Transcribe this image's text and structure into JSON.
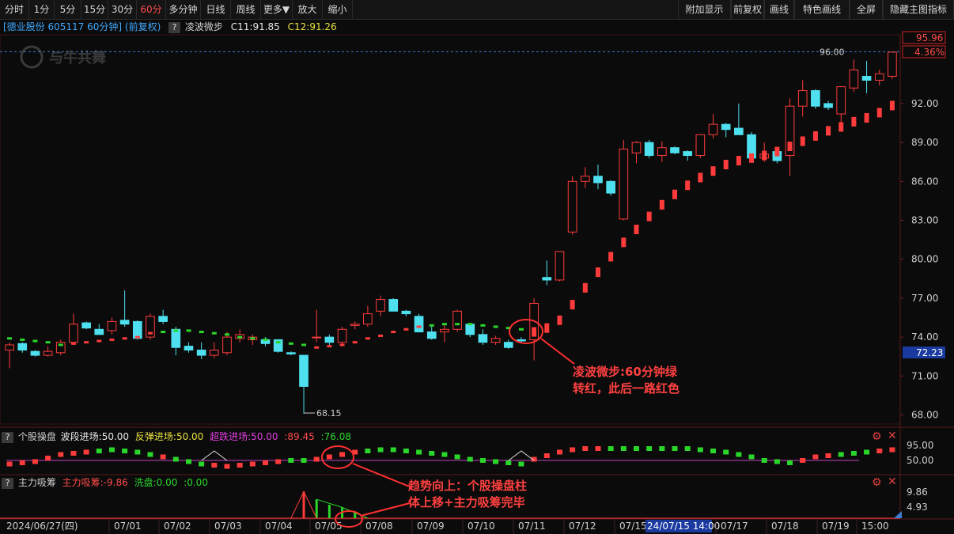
{
  "toolbar": {
    "left": [
      "分时",
      "1分",
      "5分",
      "15分",
      "30分",
      "60分",
      "多分钟",
      "日线",
      "周线",
      "更多▼",
      "放大",
      "缩小"
    ],
    "active": "60分",
    "right": [
      "附加显示",
      "前复权",
      "画线",
      "特色画线",
      "全屏",
      "隐藏主图指标"
    ]
  },
  "info": {
    "stock": "[德业股份 605117 60分钟] (前复权)",
    "indicator_name": "凌波微步",
    "c1": "C11:91.85",
    "c2": "C12:91.26",
    "watermark": "与牛共舞"
  },
  "price_axis": {
    "ticks": [
      "92.00",
      "89.00",
      "86.00",
      "83.00",
      "80.00",
      "77.00",
      "74.00",
      "71.00",
      "68.00"
    ],
    "current_price": "95.96",
    "current_pct": "4.36%",
    "cursor_price": "72.23",
    "high_label": "96.00",
    "low_label": "68.15"
  },
  "ind1": {
    "q": "?",
    "name": "个股操盘",
    "p1": "波段进场:50.00",
    "p2": "反弹进场:50.00",
    "p3": "超跌进场:50.00",
    "p4": ":89.45",
    "p5": ":76.08",
    "axis": [
      "95.00",
      "50.00"
    ]
  },
  "ind2": {
    "q": "?",
    "name": "主力吸筹",
    "p1": "主力吸筹:-9.86",
    "p2": "洗盘:0.00",
    "p3": ":0.00",
    "axis": [
      "9.86",
      "4.93"
    ]
  },
  "time_axis": [
    "2024/06/27(四)",
    "07/01",
    "07/02",
    "07/03",
    "07/04",
    "07/05",
    "07/08",
    "07/09",
    "07/10",
    "07/11",
    "07/12",
    "07/15",
    "24/07/15 14:00",
    "07/17",
    "07/18",
    "07/19",
    "15:00"
  ],
  "annotations": {
    "a1_line1": "凌波微步:60分钟绿",
    "a1_line2": "转红，此后一路红色",
    "a2_line1": "趋势向上：个股操盘柱",
    "a2_line2": "体上移+主力吸筹完毕"
  },
  "colors": {
    "up": "#ff3b3b",
    "down": "#4fe0f0",
    "green": "#2bd62b",
    "purple": "#c040c0",
    "blue_dash": "#3a7fd0"
  },
  "chart_data": {
    "type": "candlestick",
    "ylim": [
      67.3,
      97.3
    ],
    "candles": [
      [
        73.0,
        73.6,
        71.6,
        73.4
      ],
      [
        73.5,
        73.6,
        72.8,
        73.0
      ],
      [
        72.9,
        73.0,
        72.5,
        72.6
      ],
      [
        72.6,
        73.3,
        72.5,
        72.9
      ],
      [
        72.8,
        73.8,
        72.6,
        73.6
      ],
      [
        73.6,
        75.8,
        73.4,
        75.0
      ],
      [
        75.1,
        75.2,
        74.6,
        74.7
      ],
      [
        74.6,
        75.0,
        74.2,
        74.2
      ],
      [
        74.5,
        75.5,
        74.2,
        75.2
      ],
      [
        75.3,
        77.6,
        74.8,
        75.0
      ],
      [
        75.2,
        75.3,
        73.8,
        73.9
      ],
      [
        74.0,
        75.8,
        73.8,
        75.6
      ],
      [
        75.6,
        76.1,
        75.0,
        75.2
      ],
      [
        74.6,
        74.8,
        72.6,
        73.2
      ],
      [
        73.3,
        73.6,
        72.8,
        73.0
      ],
      [
        73.0,
        73.6,
        72.3,
        72.6
      ],
      [
        72.6,
        73.6,
        72.4,
        73.0
      ],
      [
        72.8,
        74.4,
        72.6,
        74.0
      ],
      [
        73.9,
        74.6,
        73.6,
        74.2
      ],
      [
        73.8,
        74.2,
        73.4,
        74.0
      ],
      [
        73.8,
        74.0,
        73.3,
        73.5
      ],
      [
        73.8,
        73.8,
        72.8,
        72.9
      ],
      [
        72.8,
        72.9,
        72.6,
        72.7
      ],
      [
        72.6,
        72.6,
        68.1,
        70.2
      ],
      [
        74.0,
        76.1,
        73.6,
        74.0
      ],
      [
        74.0,
        74.2,
        73.4,
        73.6
      ],
      [
        73.6,
        74.8,
        73.3,
        74.6
      ],
      [
        74.9,
        75.2,
        74.6,
        75.0
      ],
      [
        75.0,
        76.4,
        74.8,
        75.8
      ],
      [
        76.0,
        77.2,
        75.6,
        76.9
      ],
      [
        76.9,
        77.0,
        76.0,
        76.0
      ],
      [
        76.0,
        76.1,
        75.6,
        75.8
      ],
      [
        75.6,
        75.8,
        74.4,
        74.4
      ],
      [
        74.4,
        74.8,
        73.8,
        73.9
      ],
      [
        74.4,
        74.9,
        73.6,
        74.6
      ],
      [
        74.6,
        76.1,
        74.4,
        76.0
      ],
      [
        75.0,
        75.1,
        74.0,
        74.2
      ],
      [
        74.2,
        74.6,
        73.4,
        73.6
      ],
      [
        73.6,
        74.1,
        73.4,
        73.9
      ],
      [
        73.6,
        73.8,
        73.1,
        73.2
      ],
      [
        73.8,
        74.0,
        73.5,
        73.7
      ],
      [
        73.8,
        77.0,
        72.2,
        76.6
      ],
      [
        78.6,
        79.9,
        78.0,
        78.4
      ],
      [
        78.4,
        80.6,
        78.3,
        80.6
      ],
      [
        82.1,
        86.4,
        81.9,
        86.0
      ],
      [
        86.0,
        87.1,
        85.5,
        86.4
      ],
      [
        86.4,
        87.3,
        85.4,
        85.9
      ],
      [
        86.0,
        86.1,
        84.9,
        85.1
      ],
      [
        83.1,
        89.2,
        83.0,
        88.5
      ],
      [
        88.2,
        89.1,
        87.4,
        89.0
      ],
      [
        89.0,
        89.2,
        87.8,
        88.0
      ],
      [
        88.0,
        89.1,
        87.5,
        88.6
      ],
      [
        88.6,
        88.7,
        88.1,
        88.2
      ],
      [
        88.3,
        88.4,
        87.6,
        88.0
      ],
      [
        88.0,
        89.6,
        87.8,
        89.6
      ],
      [
        89.6,
        91.2,
        89.3,
        90.4
      ],
      [
        90.4,
        90.5,
        89.4,
        90.0
      ],
      [
        90.1,
        92.0,
        89.6,
        89.6
      ],
      [
        89.6,
        89.8,
        87.6,
        87.8
      ],
      [
        87.8,
        89.0,
        87.5,
        88.1
      ],
      [
        88.3,
        88.4,
        87.4,
        87.6
      ],
      [
        88.0,
        92.4,
        86.4,
        91.8
      ],
      [
        91.8,
        93.8,
        91.0,
        93.0
      ],
      [
        93.0,
        93.1,
        91.6,
        91.8
      ],
      [
        92.0,
        92.2,
        91.5,
        91.7
      ],
      [
        91.2,
        93.2,
        90.2,
        93.3
      ],
      [
        93.2,
        95.4,
        92.9,
        94.6
      ],
      [
        94.1,
        95.3,
        92.8,
        93.8
      ],
      [
        93.8,
        94.6,
        93.4,
        94.3
      ],
      [
        94.1,
        96.0,
        93.9,
        95.96
      ]
    ],
    "lbwb_line": [
      [
        73.9,
        "g"
      ],
      [
        73.8,
        "g"
      ],
      [
        73.7,
        "g"
      ],
      [
        73.6,
        "g"
      ],
      [
        73.4,
        "g"
      ],
      [
        73.5,
        "r"
      ],
      [
        73.6,
        "r"
      ],
      [
        73.7,
        "r"
      ],
      [
        73.8,
        "r"
      ],
      [
        73.9,
        "r"
      ],
      [
        74.0,
        "r"
      ],
      [
        74.3,
        "r"
      ],
      [
        74.4,
        "g"
      ],
      [
        74.5,
        "g"
      ],
      [
        74.5,
        "g"
      ],
      [
        74.4,
        "g"
      ],
      [
        74.3,
        "g"
      ],
      [
        74.2,
        "g"
      ],
      [
        74.0,
        "g"
      ],
      [
        73.9,
        "g"
      ],
      [
        73.8,
        "g"
      ],
      [
        73.6,
        "g"
      ],
      [
        73.5,
        "g"
      ],
      [
        73.4,
        "g"
      ],
      [
        73.2,
        "r"
      ],
      [
        73.3,
        "r"
      ],
      [
        73.4,
        "r"
      ],
      [
        73.6,
        "r"
      ],
      [
        73.9,
        "r"
      ],
      [
        74.1,
        "r"
      ],
      [
        74.4,
        "r"
      ],
      [
        74.6,
        "r"
      ],
      [
        74.8,
        "r"
      ],
      [
        74.9,
        "g"
      ],
      [
        75.0,
        "g"
      ],
      [
        75.0,
        "g"
      ],
      [
        75.0,
        "g"
      ],
      [
        74.9,
        "g"
      ],
      [
        74.8,
        "g"
      ],
      [
        74.7,
        "g"
      ],
      [
        74.6,
        "g"
      ],
      [
        74.4,
        "r"
      ],
      [
        74.7,
        "r"
      ],
      [
        75.3,
        "r"
      ],
      [
        76.5,
        "r"
      ],
      [
        77.8,
        "r"
      ],
      [
        79.0,
        "r"
      ],
      [
        80.2,
        "r"
      ],
      [
        81.3,
        "r"
      ],
      [
        82.3,
        "r"
      ],
      [
        83.3,
        "r"
      ],
      [
        84.2,
        "r"
      ],
      [
        85.0,
        "r"
      ],
      [
        85.7,
        "r"
      ],
      [
        86.3,
        "r"
      ],
      [
        86.8,
        "r"
      ],
      [
        87.3,
        "r"
      ],
      [
        87.6,
        "r"
      ],
      [
        87.8,
        "r"
      ],
      [
        88.0,
        "r"
      ],
      [
        88.3,
        "r"
      ],
      [
        88.7,
        "r"
      ],
      [
        89.1,
        "r"
      ],
      [
        89.5,
        "r"
      ],
      [
        89.9,
        "r"
      ],
      [
        90.2,
        "r"
      ],
      [
        90.6,
        "r"
      ],
      [
        90.9,
        "r"
      ],
      [
        91.3,
        "r"
      ],
      [
        91.85,
        "r"
      ]
    ],
    "cgpb_marks": [
      [
        -3,
        "r"
      ],
      [
        -2,
        "r"
      ],
      [
        -1,
        "r"
      ],
      [
        2,
        "r"
      ],
      [
        5,
        "r"
      ],
      [
        6,
        "r"
      ],
      [
        7,
        "r"
      ],
      [
        8,
        "g"
      ],
      [
        9,
        "g"
      ],
      [
        8,
        "g"
      ],
      [
        7,
        "g"
      ],
      [
        5,
        "g"
      ],
      [
        3,
        "r"
      ],
      [
        1,
        "g"
      ],
      [
        -1,
        "g"
      ],
      [
        -3,
        "g"
      ],
      [
        -4,
        "r"
      ],
      [
        -5,
        "r"
      ],
      [
        -4,
        "r"
      ],
      [
        -3,
        "r"
      ],
      [
        -2,
        "r"
      ],
      [
        -1,
        "r"
      ],
      [
        0,
        "g"
      ],
      [
        0,
        "g"
      ],
      [
        1,
        "r"
      ],
      [
        3,
        "r"
      ],
      [
        5,
        "r"
      ],
      [
        7,
        "r"
      ],
      [
        8,
        "g"
      ],
      [
        9,
        "g"
      ],
      [
        9,
        "g"
      ],
      [
        8,
        "g"
      ],
      [
        7,
        "g"
      ],
      [
        6,
        "g"
      ],
      [
        5,
        "g"
      ],
      [
        3,
        "g"
      ],
      [
        1,
        "g"
      ],
      [
        0,
        "g"
      ],
      [
        -1,
        "g"
      ],
      [
        -2,
        "g"
      ],
      [
        -3,
        "g"
      ],
      [
        1,
        "r"
      ],
      [
        4,
        "r"
      ],
      [
        7,
        "r"
      ],
      [
        9,
        "r"
      ],
      [
        10,
        "r"
      ],
      [
        10,
        "r"
      ],
      [
        10,
        "g"
      ],
      [
        10,
        "g"
      ],
      [
        10,
        "g"
      ],
      [
        10,
        "g"
      ],
      [
        10,
        "g"
      ],
      [
        10,
        "g"
      ],
      [
        10,
        "g"
      ],
      [
        9,
        "g"
      ],
      [
        8,
        "g"
      ],
      [
        7,
        "g"
      ],
      [
        5,
        "g"
      ],
      [
        3,
        "g"
      ],
      [
        0,
        "g"
      ],
      [
        -1,
        "g"
      ],
      [
        -2,
        "g"
      ],
      [
        0,
        "r"
      ],
      [
        3,
        "r"
      ],
      [
        4,
        "r"
      ],
      [
        5,
        "g"
      ],
      [
        6,
        "g"
      ],
      [
        7,
        "g"
      ],
      [
        8,
        "r"
      ],
      [
        9,
        "r"
      ]
    ],
    "zlxc_bars": [
      [
        0
      ],
      [
        0
      ],
      [
        0
      ],
      [
        0
      ],
      [
        0
      ],
      [
        0
      ],
      [
        0
      ],
      [
        0
      ],
      [
        0
      ],
      [
        0
      ],
      [
        0
      ],
      [
        0
      ],
      [
        0
      ],
      [
        0
      ],
      [
        0
      ],
      [
        0
      ],
      [
        0
      ],
      [
        0
      ],
      [
        0
      ],
      [
        0
      ],
      [
        0
      ],
      [
        0
      ],
      [
        0
      ],
      [
        9.86
      ],
      [
        7
      ],
      [
        5
      ],
      [
        4
      ],
      [
        2
      ],
      [
        0
      ],
      [
        0
      ],
      [
        0
      ],
      [
        0
      ],
      [
        0
      ],
      [
        0
      ],
      [
        0
      ],
      [
        0
      ],
      [
        0
      ],
      [
        0
      ],
      [
        0
      ],
      [
        0
      ],
      [
        0
      ],
      [
        0
      ],
      [
        0
      ],
      [
        0
      ],
      [
        0
      ],
      [
        0
      ],
      [
        0
      ],
      [
        0
      ],
      [
        0
      ],
      [
        0
      ],
      [
        0
      ],
      [
        0
      ],
      [
        0
      ],
      [
        0
      ],
      [
        0
      ],
      [
        0
      ],
      [
        0
      ],
      [
        0
      ],
      [
        0
      ],
      [
        0
      ],
      [
        0
      ],
      [
        0
      ],
      [
        0
      ],
      [
        0
      ],
      [
        0
      ],
      [
        0
      ],
      [
        0
      ],
      [
        0
      ],
      [
        0
      ],
      [
        0
      ]
    ]
  }
}
